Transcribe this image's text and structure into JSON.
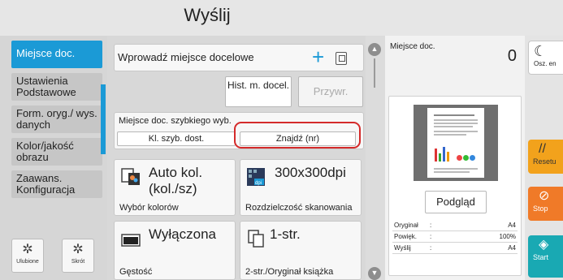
{
  "title": "Wyślij",
  "tabs": [
    "Miejsce doc.",
    "Ustawienia Podstawowe",
    "Form. oryg./ wys. danych",
    "Kolor/jakość obrazu",
    "Zaawans. Konfiguracja"
  ],
  "bottom_buttons": {
    "favorites": "Ulubione",
    "shortcut": "Skrót"
  },
  "destination": {
    "input_placeholder": "Wprowadź miejsce docelowe",
    "add_icon": "plus-icon",
    "addressbook_icon": "address-book-icon",
    "history_button": "Hist. m. docel.",
    "recall_button": "Przywr.",
    "quick_label": "Miejsce doc. szybkiego wyb.",
    "quick_button": "Kl. szyb. dost.",
    "find_button": "Znajdź (nr)"
  },
  "options": [
    {
      "value": "Auto kol. (kol./sz)",
      "label": "Wybór kolorów",
      "icon": "color-selection-icon"
    },
    {
      "value": "300x300dpi",
      "label": "Rozdzielczość skanowania",
      "icon": "dpi-icon"
    },
    {
      "value": "Wyłączona",
      "label": "Gęstość",
      "icon": "density-icon"
    },
    {
      "value": "1-str.",
      "label": "2-str./Oryginał książka",
      "icon": "duplex-icon"
    }
  ],
  "preview": {
    "title": "Miejsce doc.",
    "count": "0",
    "button": "Podgląd",
    "rows": [
      {
        "key": "Oryginał",
        "value": "A4"
      },
      {
        "key": "Powięk.",
        "value": "100%"
      },
      {
        "key": "Wyślij",
        "value": "A4"
      }
    ]
  },
  "actions": {
    "energy": "Osz. en",
    "reset": "Resetu",
    "stop": "Stop",
    "start": "Start"
  },
  "colors": {
    "accent": "#1b9ad6",
    "highlight": "#d42a2a",
    "reset": "#f2a21c",
    "stop": "#f07a28",
    "start": "#19a9b3"
  }
}
